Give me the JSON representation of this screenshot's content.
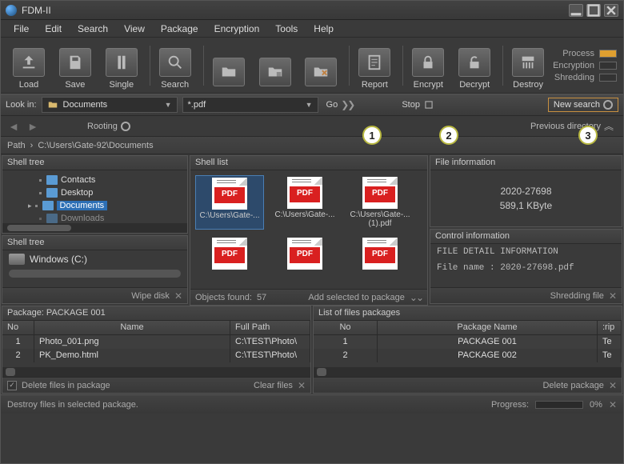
{
  "app": {
    "title": "FDM-II"
  },
  "menu": [
    "File",
    "Edit",
    "Search",
    "View",
    "Package",
    "Encryption",
    "Tools",
    "Help"
  ],
  "toolbar": [
    {
      "label": "Load",
      "icon": "load"
    },
    {
      "label": "Save",
      "icon": "save"
    },
    {
      "label": "Single",
      "icon": "single"
    },
    {
      "label": "Search",
      "icon": "search"
    },
    {
      "label": "",
      "icon": "folder-open"
    },
    {
      "label": "",
      "icon": "folder-save"
    },
    {
      "label": "",
      "icon": "delete-folder"
    },
    {
      "label": "Report",
      "icon": "report"
    },
    {
      "label": "Encrypt",
      "icon": "lock"
    },
    {
      "label": "Decrypt",
      "icon": "unlock"
    },
    {
      "label": "Destroy",
      "icon": "shred"
    }
  ],
  "status_leds": [
    {
      "label": "Process",
      "on": true
    },
    {
      "label": "Encryption",
      "on": false
    },
    {
      "label": "Shredding",
      "on": false
    }
  ],
  "searchbar": {
    "lookin_label": "Look in:",
    "lookin_value": "Documents",
    "filter_value": "*.pdf",
    "go": "Go",
    "stop": "Stop",
    "newsearch": "New search"
  },
  "callouts": [
    "1",
    "2",
    "3"
  ],
  "nav": {
    "rooting": "Rooting",
    "prev": "Previous directory"
  },
  "path": {
    "label": "Path",
    "value": "C:\\Users\\Gate-92\\Documents"
  },
  "shelltree": {
    "title": "Shell tree",
    "items": [
      "Contacts",
      "Desktop",
      "Documents",
      "Downloads"
    ],
    "selected": "Documents"
  },
  "drive": {
    "title": "Shell tree",
    "name": "Windows (C:)",
    "wipe": "Wipe disk"
  },
  "shelllist": {
    "title": "Shell list",
    "files": [
      {
        "label": "C:\\Users\\Gate-...",
        "sel": true
      },
      {
        "label": "C:\\Users\\Gate-..."
      },
      {
        "label": "C:\\Users\\Gate-... (1).pdf"
      },
      {
        "label": ""
      },
      {
        "label": ""
      },
      {
        "label": ""
      }
    ],
    "found_label": "Objects found:",
    "found_count": "57",
    "add": "Add selected to package"
  },
  "fileinfo": {
    "title": "File information",
    "name": "2020-27698",
    "size": "589,1 KByte"
  },
  "ctrlinfo": {
    "title": "Control information",
    "line1": "FILE DETAIL INFORMATION",
    "line2": "File name   : 2020-27698.pdf",
    "shredding": "Shredding file"
  },
  "pkg_table": {
    "title": "Package: PACKAGE 001",
    "cols": [
      "No",
      "Name",
      "Full Path"
    ],
    "rows": [
      {
        "no": "1",
        "name": "Photo_001.png",
        "path": "C:\\TEST\\Photo\\"
      },
      {
        "no": "2",
        "name": "PK_Demo.html",
        "path": "C:\\TEST\\Photo\\"
      }
    ],
    "delete": "Delete files in package",
    "clear": "Clear files"
  },
  "pkglist_table": {
    "title": "List of files packages",
    "cols": [
      "No",
      "Package Name",
      "Description"
    ],
    "rows": [
      {
        "no": "1",
        "name": "PACKAGE 001",
        "d": "Te"
      },
      {
        "no": "2",
        "name": "PACKAGE 002",
        "d": "Te"
      }
    ],
    "delete": "Delete package"
  },
  "footer": {
    "hint": "Destroy files in selected package.",
    "progress_label": "Progress:",
    "progress_value": "0%"
  }
}
